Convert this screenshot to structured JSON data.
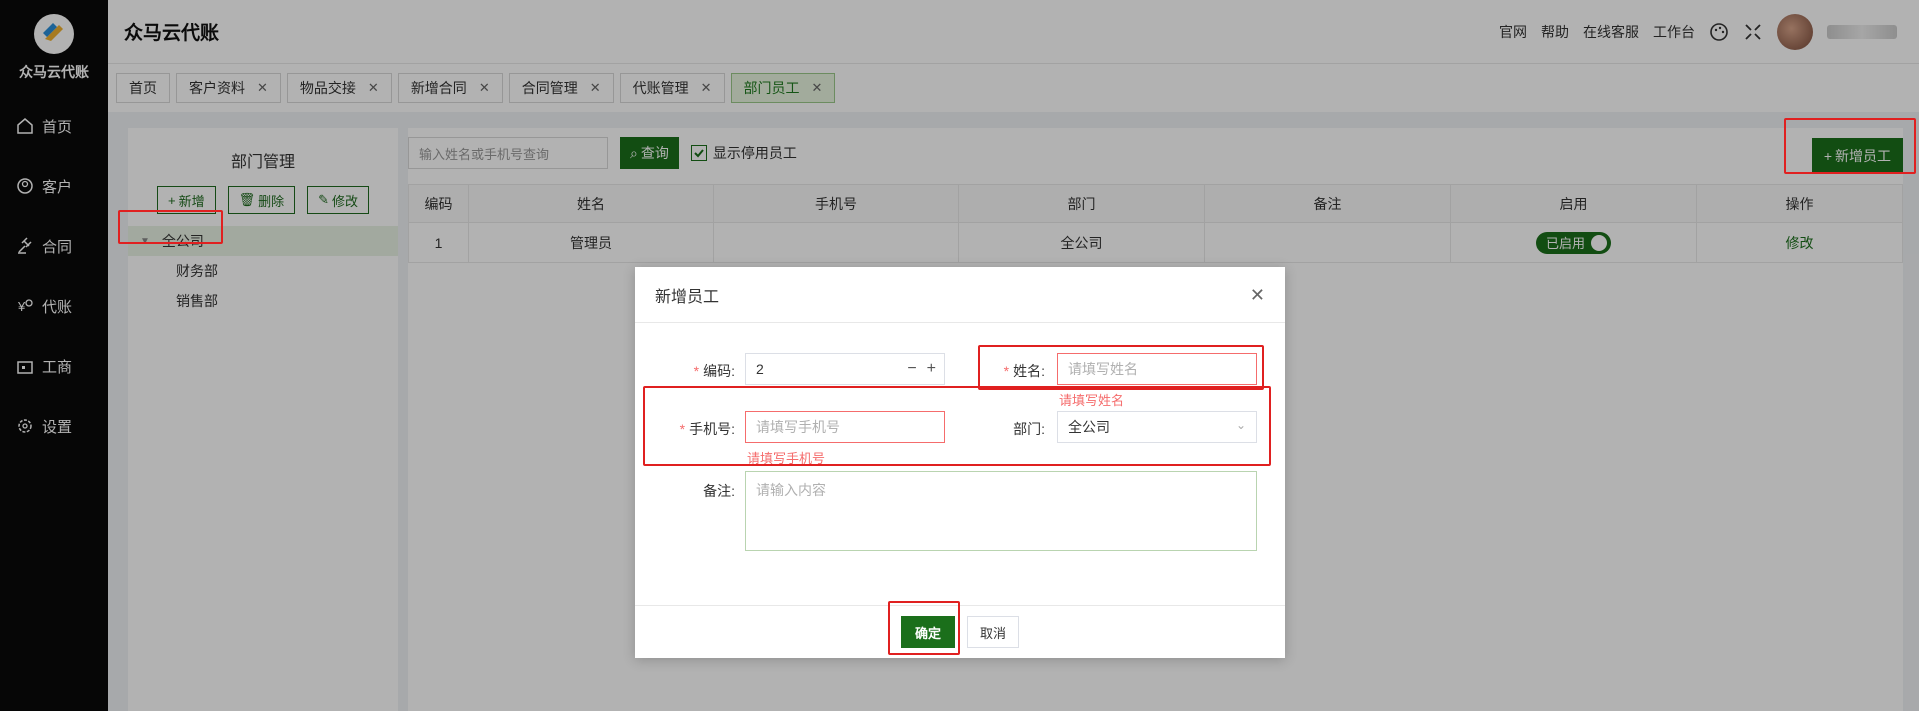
{
  "sidebar": {
    "logo_text": "众马云代账",
    "items": [
      {
        "icon": "home-icon",
        "label": "首页"
      },
      {
        "icon": "user-circle-icon",
        "label": "客户"
      },
      {
        "icon": "gavel-icon",
        "label": "合同"
      },
      {
        "icon": "money-icon",
        "label": "代账"
      },
      {
        "icon": "building-icon",
        "label": "工商"
      },
      {
        "icon": "gear-icon",
        "label": "设置"
      }
    ]
  },
  "header": {
    "title": "众马云代账",
    "links": [
      "官网",
      "帮助",
      "在线客服",
      "工作台"
    ]
  },
  "tabs": [
    {
      "label": "首页",
      "closable": false
    },
    {
      "label": "客户资料",
      "closable": true
    },
    {
      "label": "物品交接",
      "closable": true
    },
    {
      "label": "新增合同",
      "closable": true
    },
    {
      "label": "合同管理",
      "closable": true
    },
    {
      "label": "代账管理",
      "closable": true
    },
    {
      "label": "部门员工",
      "closable": true,
      "active": true
    }
  ],
  "dept_panel": {
    "title": "部门管理",
    "buttons": {
      "add": "新增",
      "delete": "删除",
      "edit": "修改"
    },
    "tree": {
      "root": "全公司",
      "children": [
        "财务部",
        "销售部"
      ]
    }
  },
  "toolbar": {
    "search_placeholder": "输入姓名或手机号查询",
    "search_button": "查询",
    "show_disabled_label": "显示停用员工",
    "add_employee_button": "新增员工"
  },
  "table": {
    "columns": [
      "编码",
      "姓名",
      "手机号",
      "部门",
      "备注",
      "启用",
      "操作"
    ],
    "rows": [
      {
        "code": "1",
        "name": "管理员",
        "phone": "",
        "dept": "全公司",
        "note": "",
        "status": "已启用",
        "action": "修改"
      }
    ]
  },
  "dialog": {
    "title": "新增员工",
    "code_label": "编码:",
    "code_value": "2",
    "name_label": "姓名:",
    "name_placeholder": "请填写姓名",
    "name_error": "请填写姓名",
    "phone_label": "手机号:",
    "phone_placeholder": "请填写手机号",
    "phone_error": "请填写手机号",
    "dept_label": "部门:",
    "dept_value": "全公司",
    "note_label": "备注:",
    "note_placeholder": "请输入内容",
    "confirm": "确定",
    "cancel": "取消"
  },
  "colors": {
    "primary": "#1b6f1b",
    "error": "#f56c6c",
    "highlight": "#e02020"
  }
}
